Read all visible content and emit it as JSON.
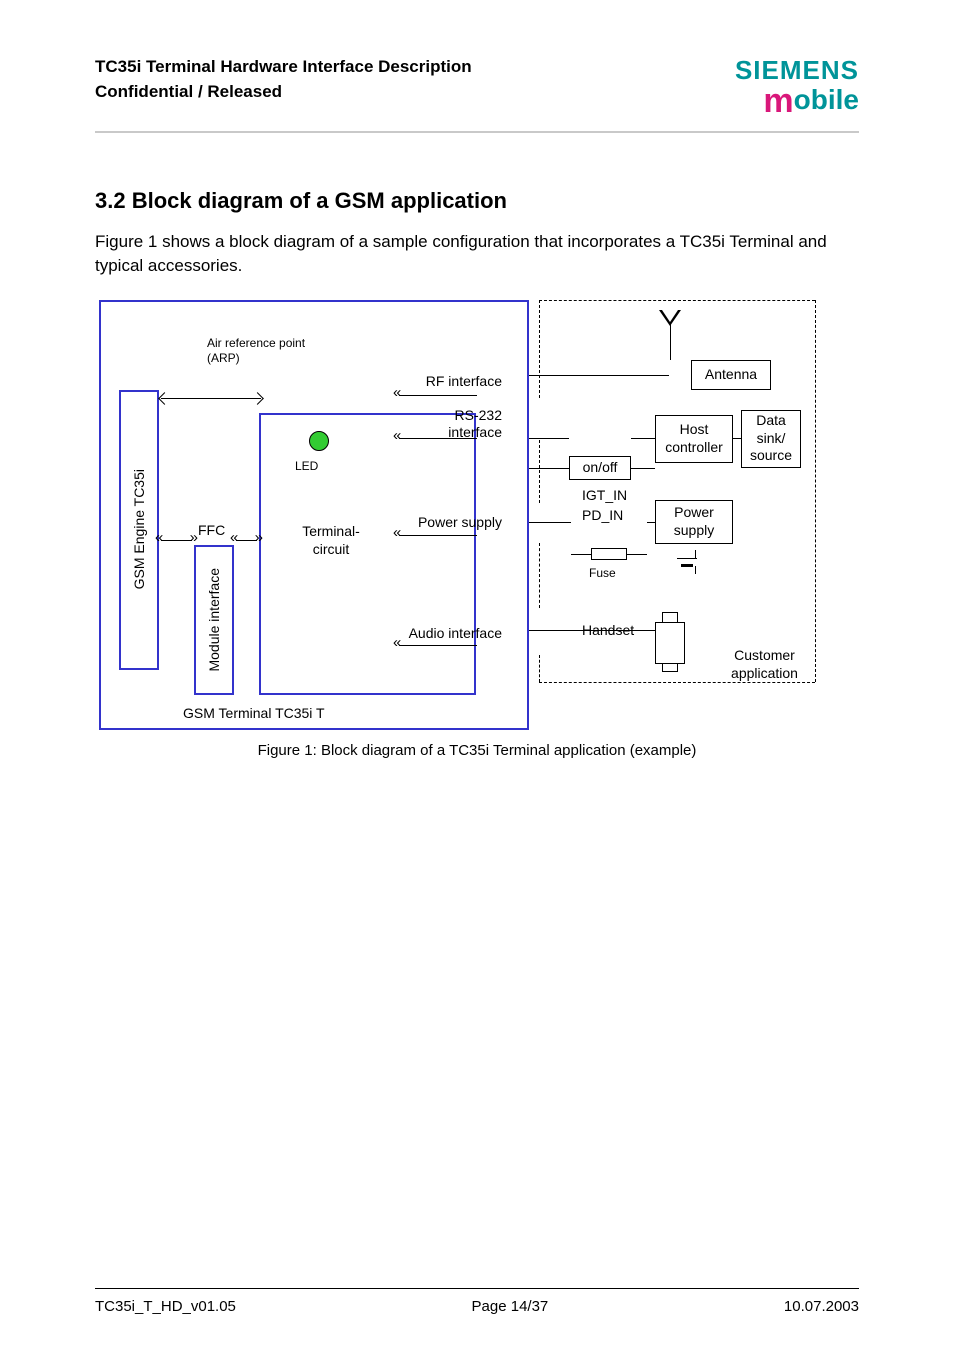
{
  "header": {
    "line1": "TC35i Terminal Hardware Interface Description",
    "line2": "Confidential / Released",
    "logo_top": "SIEMENS",
    "logo_bottom_lead": "m",
    "logo_bottom_rest": "obile"
  },
  "section": {
    "heading": "3.2  Block diagram of a GSM application",
    "paragraph": "Figure 1 shows a block diagram of a sample configuration that incorporates a TC35i Terminal and typical accessories."
  },
  "diagram": {
    "arp": "Air reference point\n(ARP)",
    "gsm_engine": "GSM Engine TC35i",
    "module_interface": "Module interface",
    "ffc": "FFC",
    "terminal_circuit": "Terminal-\ncircuit",
    "led": "LED",
    "iface_rf": "RF interface",
    "iface_rs232": "RS-232\ninterface",
    "iface_power": "Power supply",
    "iface_audio": "Audio interface",
    "gsm_terminal": "GSM Terminal TC35i T",
    "antenna": "Antenna",
    "host": "Host\ncontroller",
    "data": "Data\nsink/\nsource",
    "onoff": "on/off",
    "igt": "IGT_IN",
    "pdin": "PD_IN",
    "power_supply": "Power\nsupply",
    "fuse": "Fuse",
    "handset": "Handset",
    "customer_app": "Customer\napplication"
  },
  "figure_caption": "Figure 1: Block diagram of a TC35i Terminal application (example)",
  "footer": {
    "left": "TC35i_T_HD_v01.05",
    "center": "Page 14/37",
    "right": "10.07.2003"
  }
}
